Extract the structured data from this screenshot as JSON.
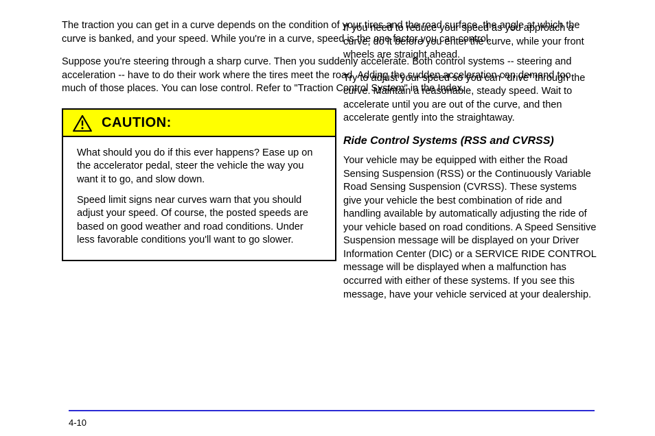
{
  "left": {
    "p1": "The traction you can get in a curve depends on the condition of your tires and the road surface, the angle at which the curve is banked, and your speed. While you're in a curve, speed is the one factor you can control.",
    "p2": "Suppose you're steering through a sharp curve. Then you suddenly accelerate. Both control systems -- steering and acceleration -- have to do their work where the tires meet the road. Adding the sudden acceleration can demand too much of those places. You can lose control. Refer to \"Traction Control System\" in the Index."
  },
  "caution": {
    "label": "CAUTION:",
    "body1": "What should you do if this ever happens? Ease up on the accelerator pedal, steer the vehicle the way you want it to go, and slow down.",
    "body2": "Speed limit signs near curves warn that you should adjust your speed. Of course, the posted speeds are based on good weather and road conditions. Under less favorable conditions you'll want to go slower."
  },
  "right": {
    "p1": "If you need to reduce your speed as you approach a curve, do it before you enter the curve, while your front wheels are straight ahead.",
    "p2": "Try to adjust your speed so you can \"drive\" through the curve. Maintain a reasonable, steady speed. Wait to accelerate until you are out of the curve, and then accelerate gently into the straightaway.",
    "ride_heading": "Ride Control Systems (RSS and CVRSS)",
    "p3": "Your vehicle may be equipped with either the Road Sensing Suspension (RSS) or the Continuously Variable Road Sensing Suspension (CVRSS). These systems give your vehicle the best combination of ride and handling available by automatically adjusting the ride of your vehicle based on road conditions. A Speed Sensitive Suspension message will be displayed on your Driver Information Center (DIC) or a SERVICE RIDE CONTROL message will be displayed when a malfunction has occurred with either of these systems. If you see this message, have your vehicle serviced at your dealership."
  },
  "page_number": "4-10"
}
